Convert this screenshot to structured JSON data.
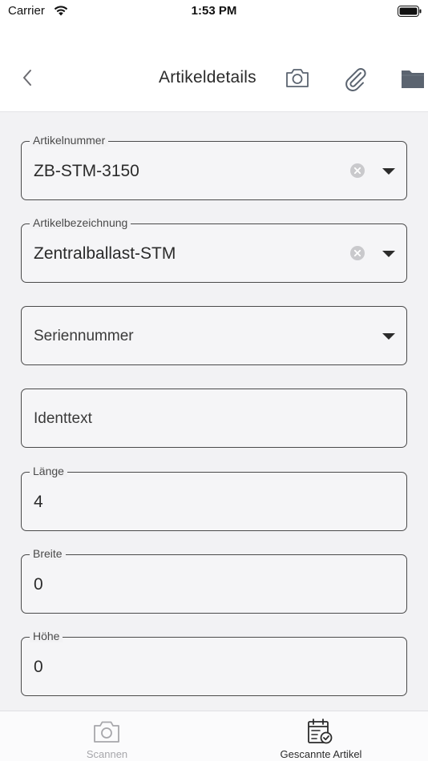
{
  "status_bar": {
    "carrier": "Carrier",
    "time": "1:53 PM",
    "wifi_icon": "wifi-icon",
    "battery_icon": "battery-icon"
  },
  "nav": {
    "title": "Artikeldetails",
    "back_icon": "chevron-left-icon",
    "actions": [
      "camera-icon",
      "paperclip-icon",
      "folder-icon"
    ]
  },
  "fields": [
    {
      "label": "Artikelnummer",
      "value": "ZB-STM-3150",
      "clearable": true,
      "dropdown": true
    },
    {
      "label": "Artikelbezeichnung",
      "value": "Zentralballast-STM",
      "clearable": true,
      "dropdown": true
    },
    {
      "label": "",
      "placeholder": "Seriennummer",
      "dropdown": true
    },
    {
      "label": "",
      "placeholder": "Identtext"
    },
    {
      "label": "Länge",
      "value": "4"
    },
    {
      "label": "Breite",
      "value": "0"
    },
    {
      "label": "Höhe",
      "value": "0"
    }
  ],
  "tab_bar": {
    "tabs": [
      {
        "label": "Scannen",
        "icon": "camera-icon",
        "active": false
      },
      {
        "label": "Gescannte Artikel",
        "icon": "calendar-check-icon",
        "active": true
      }
    ]
  },
  "colors": {
    "text": "#2b2b2b",
    "border": "#4a4a4a",
    "background": "#f2f2f4",
    "nav_icon": "#5b6470",
    "inactive_tab": "#a7a7ab"
  }
}
